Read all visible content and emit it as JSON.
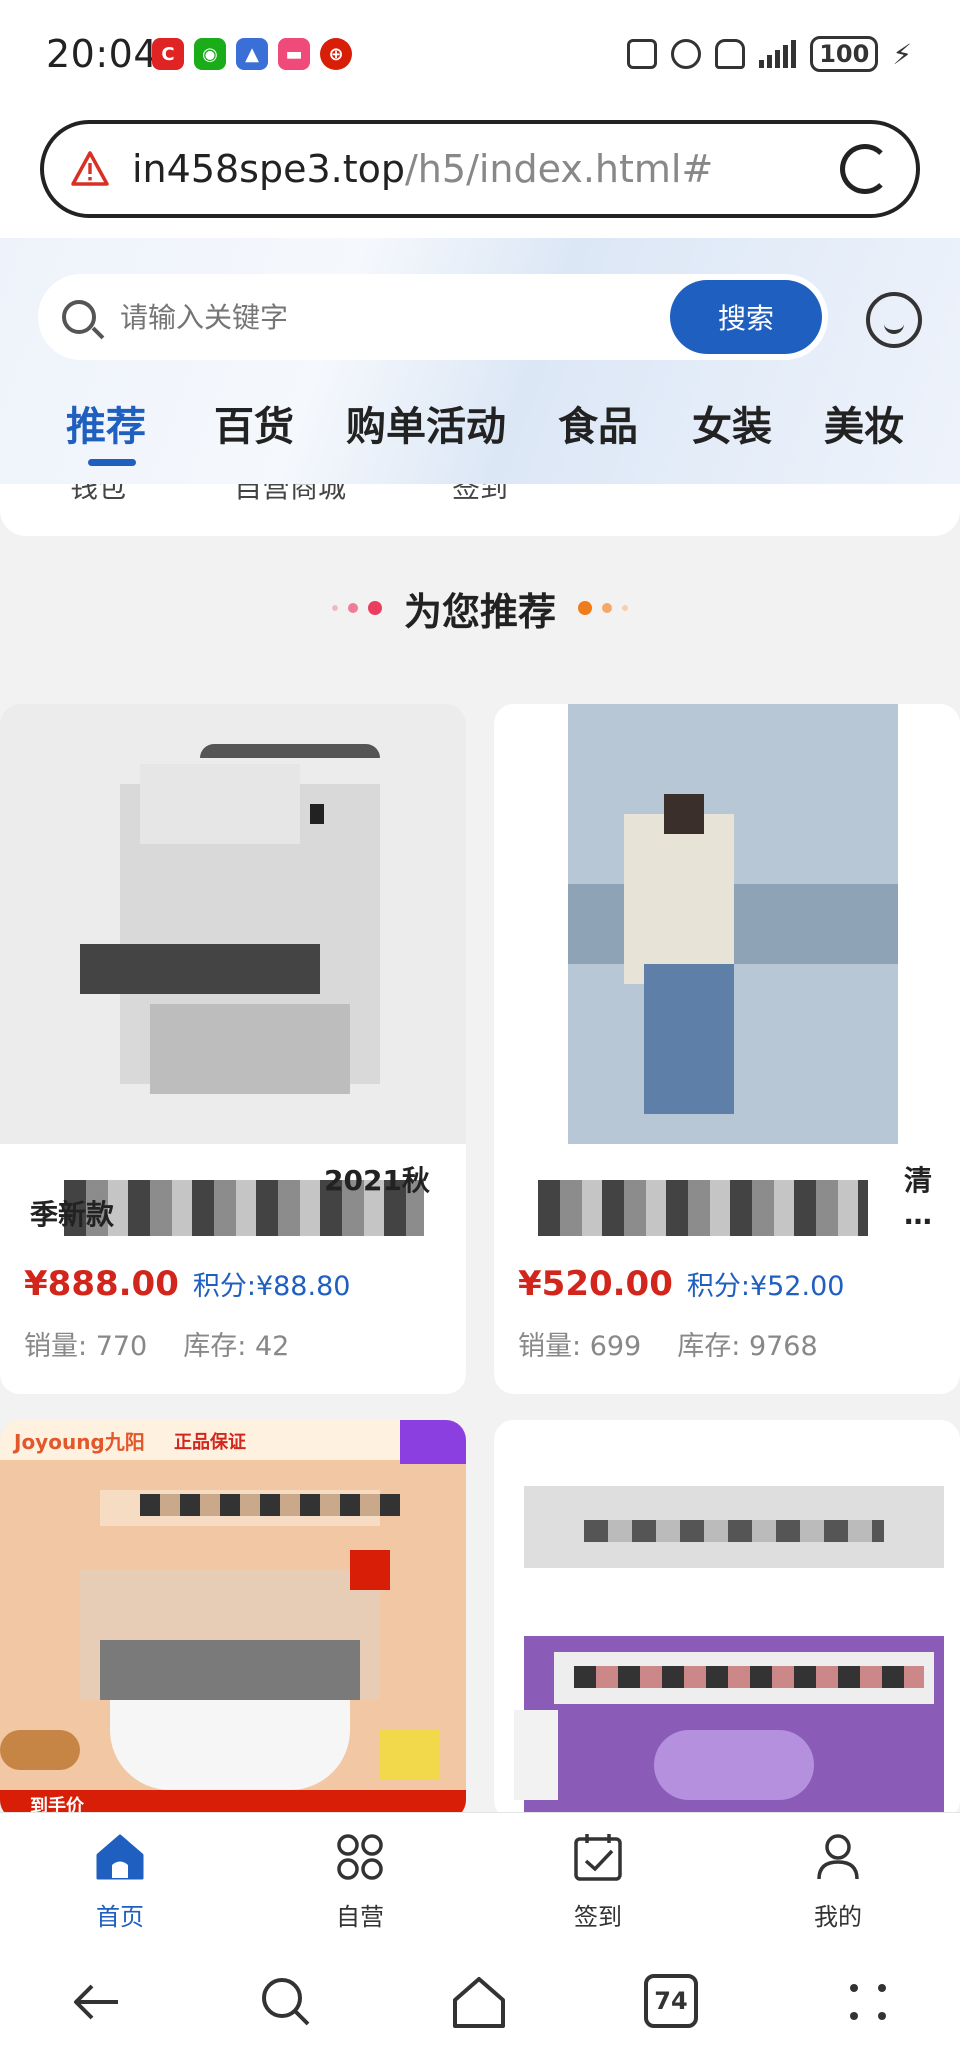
{
  "status": {
    "time": "20:04",
    "battery": "100",
    "apps": [
      {
        "icon": "c-app-icon",
        "glyph": "C",
        "color": "#e02424"
      },
      {
        "icon": "wechat-icon",
        "glyph": "◉",
        "color": "#1aad19"
      },
      {
        "icon": "app-icon-3",
        "glyph": "▲",
        "color": "#3a6fd8"
      },
      {
        "icon": "app-icon-4",
        "glyph": "▬",
        "color": "#ef4a7a"
      },
      {
        "icon": "bank-icon",
        "glyph": "⊕",
        "color": "#d81e06"
      }
    ]
  },
  "browser": {
    "url_host": "in458spe3.top",
    "url_path": "/h5/index.html#",
    "tab_count": "74"
  },
  "header": {
    "search_placeholder": "请输入关键字",
    "search_button": "搜索",
    "tabs": [
      "推荐",
      "百货",
      "购单活动",
      "食品",
      "女装",
      "美妆"
    ]
  },
  "remnant_labels": [
    "钱包",
    "自营商城",
    "签到"
  ],
  "section_title": "为您推荐",
  "products": [
    {
      "name_visible_1": "2021秋",
      "name_visible_2": "季新款",
      "price": "¥888.00",
      "points": "积分:¥88.80",
      "sales_label": "销量:",
      "sales": "770",
      "stock_label": "库存:",
      "stock": "42"
    },
    {
      "name_visible_1": "清",
      "name_visible_2": "…",
      "price": "¥520.00",
      "points": "积分:¥52.00",
      "sales_label": "销量:",
      "sales": "699",
      "stock_label": "库存:",
      "stock": "9768"
    },
    {
      "brand": "Joyoung九阳",
      "badge": "正品保证",
      "tag": "到手价"
    },
    {}
  ],
  "tabbar": [
    {
      "label": "首页",
      "icon": "home-icon",
      "active": true
    },
    {
      "label": "自营",
      "icon": "grid-icon",
      "active": false
    },
    {
      "label": "签到",
      "icon": "calendar-check-icon",
      "active": false
    },
    {
      "label": "我的",
      "icon": "user-icon",
      "active": false
    }
  ],
  "colors": {
    "accent": "#1f5fbf",
    "price": "#d2261c"
  }
}
